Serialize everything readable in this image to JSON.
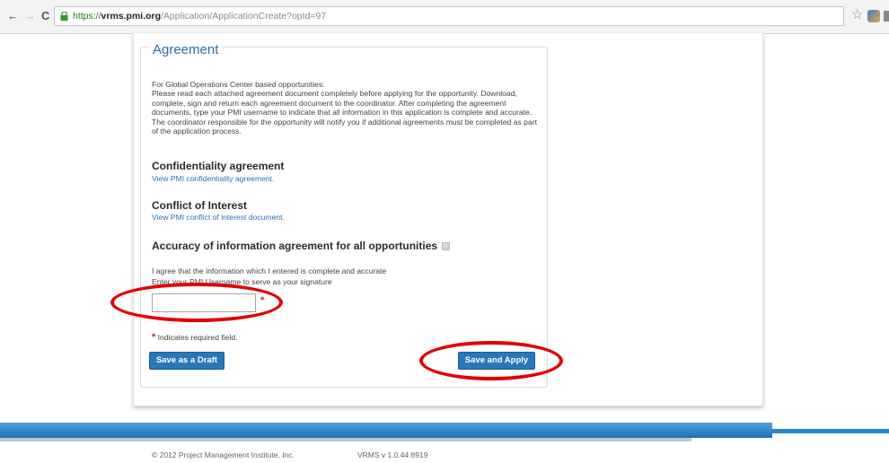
{
  "browser": {
    "url_prefix": "https://",
    "url_host": "vrms.pmi.org",
    "url_path": "/Application/ApplicationCreate?opId=97",
    "back_glyph": "←",
    "forward_glyph": "→",
    "reload_glyph": "C",
    "star_glyph": "☆"
  },
  "form": {
    "legend": "Agreement",
    "intro_heading": "For Global Operations Center based opportunities:",
    "intro_body": "Please read each attached agreement document completely before applying for the opportunity. Download, complete, sign and return each agreement document to the coordinator. After completing the agreement documents, type your PMI username to indicate that all information in this application is complete and accurate. The coordinator responsible for the opportunity will notify you if additional agreements must be completed as part of the application process.",
    "confidentiality": {
      "title": "Confidentiality agreement",
      "link": "View PMI confidentiality agreement."
    },
    "conflict": {
      "title": "Conflict of Interest",
      "link": "View PMI conflict of interest document."
    },
    "accuracy": {
      "title": "Accuracy of information agreement for all opportunities",
      "agree_text": "I agree that the information which I entered is complete and accurate",
      "signature_prompt": "Enter your PMI Username to serve as your signature",
      "username_value": ""
    },
    "required_star": "*",
    "required_note": "Indicates required field.",
    "save_draft_label": "Save as a Draft",
    "save_apply_label": "Save and Apply"
  },
  "footer": {
    "copyright": "© 2012 Project Management Institute, Inc.",
    "version": "VRMS v 1.0.44.8919"
  },
  "colors": {
    "link": "#2a72b5",
    "button": "#2a77b8",
    "annotation": "#e30000",
    "footer_bar": "#1b72b8"
  }
}
